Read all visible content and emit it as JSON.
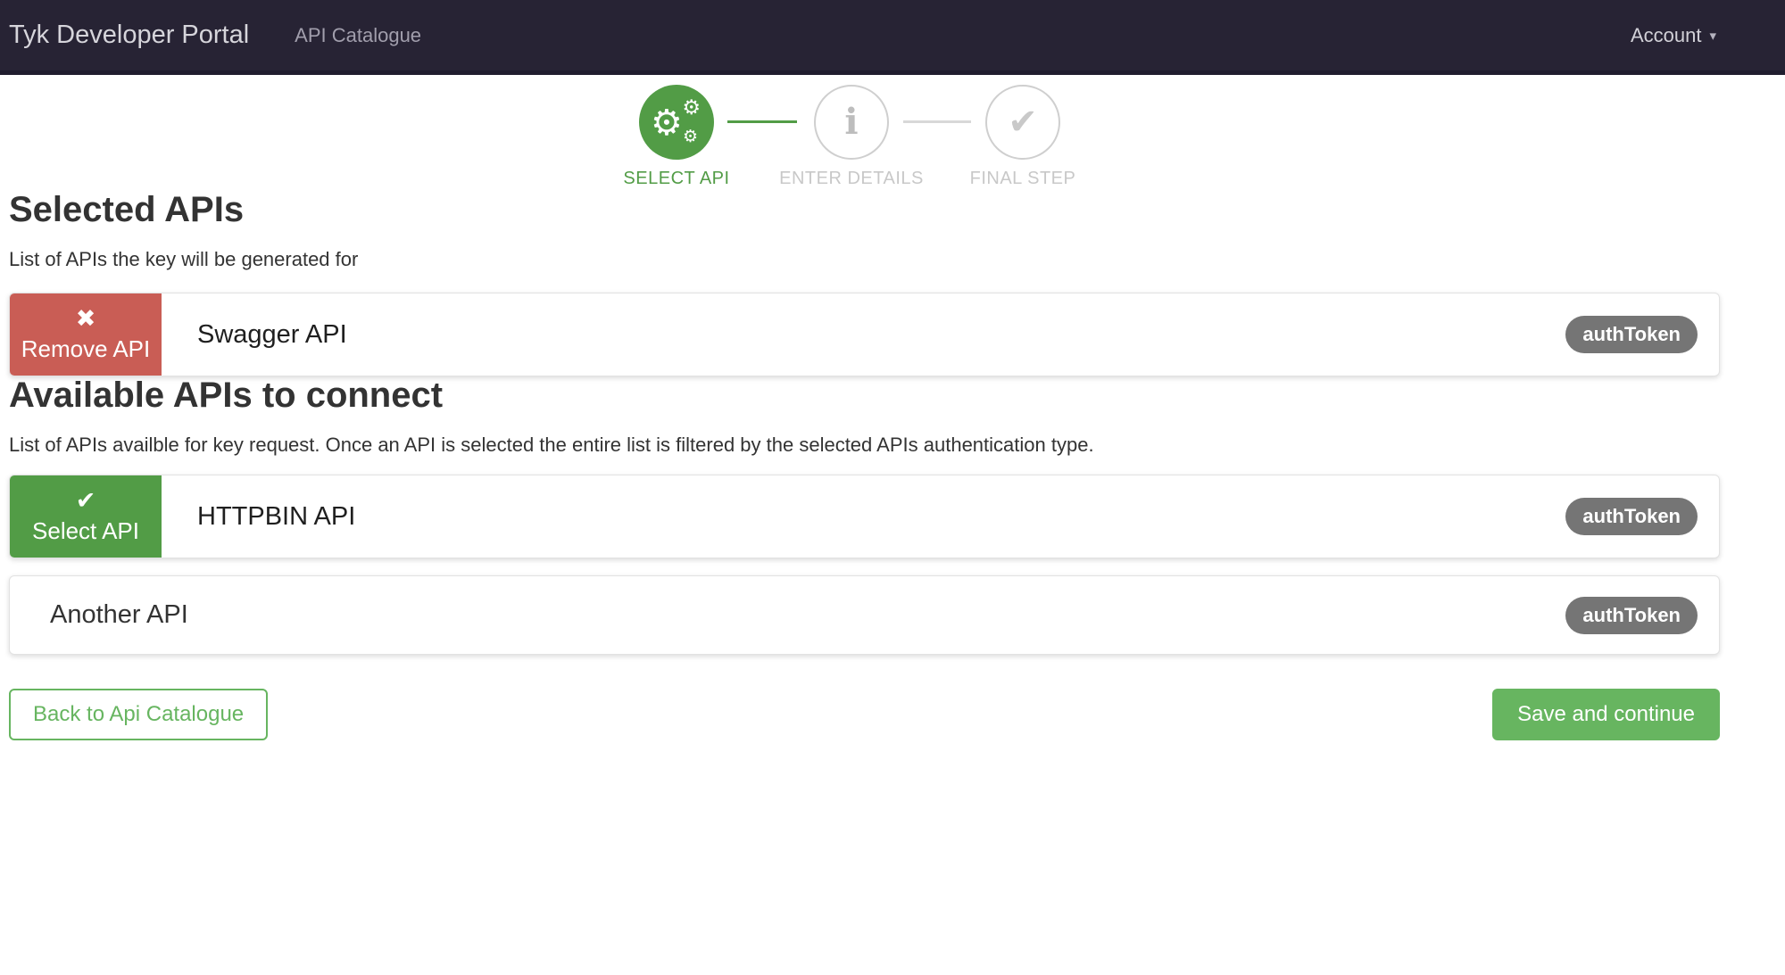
{
  "navbar": {
    "brand": "Tyk Developer Portal",
    "nav_item": "API Catalogue",
    "account_label": "Account",
    "caret_icon": "▾"
  },
  "stepper": {
    "steps": [
      {
        "label": "SELECT API",
        "icon": "gears-icon",
        "state": "active"
      },
      {
        "label": "ENTER DETAILS",
        "icon": "info-icon",
        "state": "upcoming"
      },
      {
        "label": "FINAL STEP",
        "icon": "check-icon",
        "state": "upcoming"
      }
    ]
  },
  "icons": {
    "gear": "⚙",
    "info": "i",
    "check": "✔",
    "remove": "✖"
  },
  "sections": {
    "selected": {
      "title": "Selected APIs",
      "subtitle": "List of APIs the key will be generated for",
      "apis": [
        {
          "name": "Swagger API",
          "auth_type": "authToken",
          "action_label": "Remove API"
        }
      ]
    },
    "available": {
      "title": "Available APIs to connect",
      "subtitle": "List of APIs availble for key request. Once an API is selected the entire list is filtered by the selected APIs authentication type.",
      "apis": [
        {
          "name": "HTTPBIN API",
          "auth_type": "authToken",
          "action_label": "Select API"
        },
        {
          "name": "Another API",
          "auth_type": "authToken"
        }
      ]
    }
  },
  "footer": {
    "back_label": "Back to Api Catalogue",
    "save_label": "Save and continue"
  },
  "colors": {
    "navbar_bg": "#272334",
    "green_dark": "#529c46",
    "green_light": "#67b560",
    "red": "#c95d55",
    "badge_gray": "#757575"
  }
}
